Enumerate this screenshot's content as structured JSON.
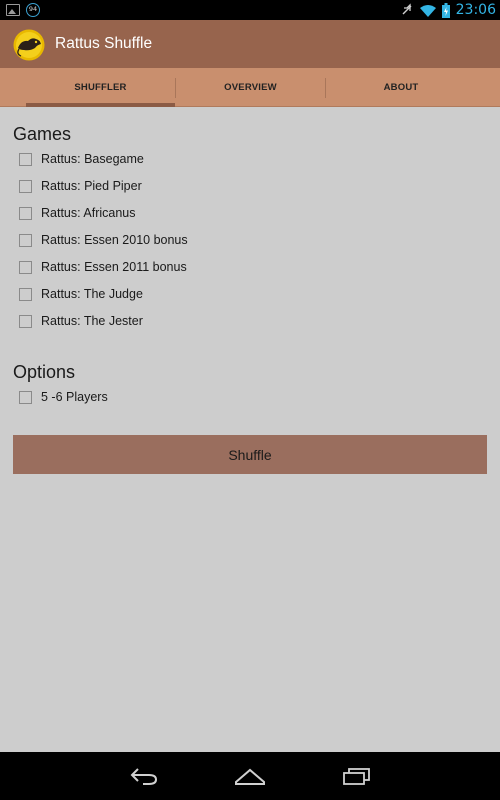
{
  "status_bar": {
    "notification_badge": "94",
    "time": "23:06",
    "time_color": "#33b5e5"
  },
  "action_bar": {
    "title": "Rattus Shuffle",
    "background": "#97644d"
  },
  "tabs": [
    {
      "label": "SHUFFLER",
      "selected": true
    },
    {
      "label": "OVERVIEW",
      "selected": false
    },
    {
      "label": "ABOUT",
      "selected": false
    }
  ],
  "games": {
    "title": "Games",
    "items": [
      {
        "label": "Rattus: Basegame",
        "checked": false
      },
      {
        "label": "Rattus: Pied Piper",
        "checked": false
      },
      {
        "label": "Rattus: Africanus",
        "checked": false
      },
      {
        "label": "Rattus: Essen 2010 bonus",
        "checked": false
      },
      {
        "label": "Rattus: Essen 2011 bonus",
        "checked": false
      },
      {
        "label": "Rattus: The Judge",
        "checked": false
      },
      {
        "label": "Rattus: The Jester",
        "checked": false
      }
    ]
  },
  "options": {
    "title": "Options",
    "items": [
      {
        "label": "5 -6 Players",
        "checked": false
      }
    ]
  },
  "shuffle_button": {
    "label": "Shuffle",
    "color": "#9a6e5e"
  },
  "nav_icons": [
    "back-icon",
    "home-icon",
    "recent-apps-icon"
  ]
}
